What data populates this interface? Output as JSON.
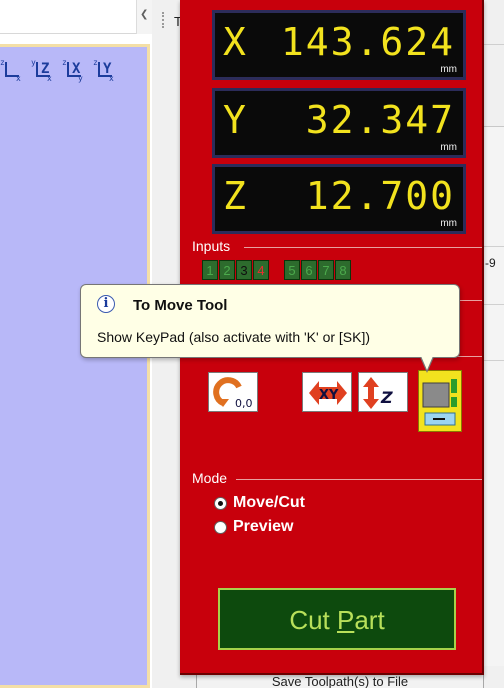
{
  "dro": [
    {
      "axis": "X",
      "value": "143.624",
      "unit": "mm"
    },
    {
      "axis": "Y",
      "value": "32.347",
      "unit": "mm"
    },
    {
      "axis": "Z",
      "value": "12.700",
      "unit": "mm"
    }
  ],
  "inputs": {
    "label": "Inputs",
    "leds": [
      {
        "num": "1",
        "active": false
      },
      {
        "num": "2",
        "active": false
      },
      {
        "num": "3",
        "active": true
      },
      {
        "num": "4",
        "active": true
      },
      {
        "num": "5",
        "active": false
      },
      {
        "num": "6",
        "active": false
      },
      {
        "num": "7",
        "active": false
      },
      {
        "num": "8",
        "active": false
      }
    ]
  },
  "tooltip": {
    "title": "To Move Tool",
    "body": "Show KeyPad (also activate with 'K' or [SK])"
  },
  "mode": {
    "label": "Mode",
    "options": [
      {
        "label": "Move/Cut",
        "selected": true
      },
      {
        "label": "Preview",
        "selected": false
      }
    ]
  },
  "cut_button": {
    "pre": "Cut ",
    "underlined": "P",
    "post": "art"
  },
  "background": {
    "save_button": "Save Toolpath(s) to File",
    "tab_fragment": "T",
    "right_fragment": "-9"
  },
  "view_icons": [
    {
      "name": "iso-view",
      "label": "",
      "sup": "z",
      "sub": "x"
    },
    {
      "name": "view-z",
      "label": "Z",
      "sup": "y",
      "sub": "x"
    },
    {
      "name": "view-x",
      "label": "X",
      "sup": "z",
      "sub": "y"
    },
    {
      "name": "view-y",
      "label": "Y",
      "sup": "z",
      "sub": "x"
    }
  ],
  "colors": {
    "panel": "#c8000c",
    "dro_digits": "#f2e21e",
    "led_on": "#f2e21e",
    "led_off": "#4caa4c",
    "led_alert": "#e83030",
    "cut_text": "#b8e05a"
  }
}
